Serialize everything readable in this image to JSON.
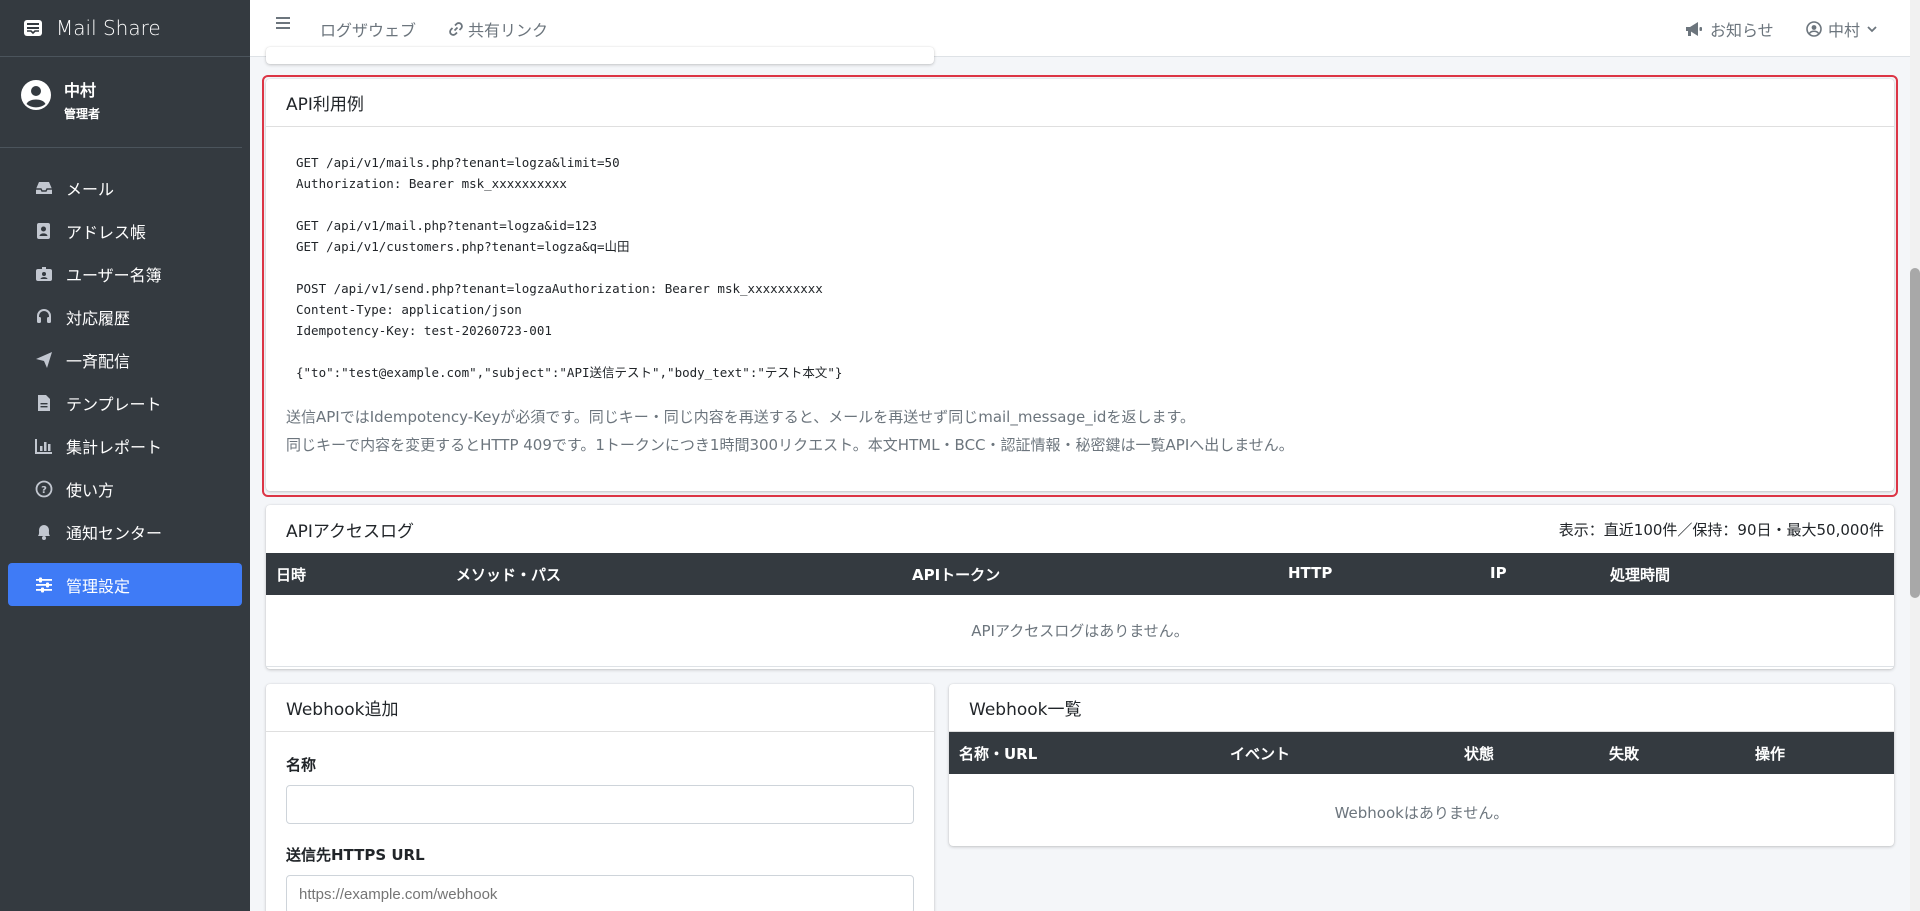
{
  "app": {
    "brand": "Mail Share"
  },
  "user": {
    "name": "中村",
    "role": "管理者"
  },
  "sidebar": {
    "items": [
      {
        "label": "メール",
        "icon": "inbox-icon"
      },
      {
        "label": "アドレス帳",
        "icon": "address-book-icon"
      },
      {
        "label": "ユーザー名簿",
        "icon": "id-card-icon"
      },
      {
        "label": "対応履歴",
        "icon": "headset-icon"
      },
      {
        "label": "一斉配信",
        "icon": "paper-plane-icon"
      },
      {
        "label": "テンプレート",
        "icon": "file-icon"
      },
      {
        "label": "集計レポート",
        "icon": "chart-icon"
      },
      {
        "label": "使い方",
        "icon": "question-icon"
      },
      {
        "label": "通知センター",
        "icon": "bell-icon"
      },
      {
        "label": "管理設定",
        "icon": "sliders-icon",
        "active": true
      }
    ]
  },
  "topbar": {
    "link1": "ログザウェブ",
    "link2": "共有リンク",
    "notice": "お知らせ",
    "user": "中村"
  },
  "api_example": {
    "title": "API利用例",
    "code": [
      "GET /api/v1/mails.php?tenant=logza&limit=50",
      "Authorization: Bearer msk_xxxxxxxxxx",
      "",
      "GET /api/v1/mail.php?tenant=logza&id=123",
      "GET /api/v1/customers.php?tenant=logza&q=山田",
      "",
      "POST /api/v1/send.php?tenant=logzaAuthorization: Bearer msk_xxxxxxxxxx",
      "Content-Type: application/json",
      "Idempotency-Key: test-20260723-001",
      "",
      "{\"to\":\"test@example.com\",\"subject\":\"API送信テスト\",\"body_text\":\"テスト本文\"}"
    ],
    "note1": "送信APIではIdempotency-Keyが必須です。同じキー・同じ内容を再送すると、メールを再送せず同じmail_message_idを返します。",
    "note2": "同じキーで内容を変更するとHTTP 409です。1トークンにつき1時間300リクエスト。本文HTML・BCC・認証情報・秘密鍵は一覧APIへ出しません。"
  },
  "access_log": {
    "title": "APIアクセスログ",
    "meta": "表示：直近100件／保持：90日・最大50,000件",
    "columns": [
      "日時",
      "メソッド・パス",
      "APIトークン",
      "HTTP",
      "IP",
      "処理時間"
    ],
    "empty": "APIアクセスログはありません。"
  },
  "webhook_add": {
    "title": "Webhook追加",
    "name_label": "名称",
    "name_value": "",
    "url_label": "送信先HTTPS URL",
    "url_placeholder": "https://example.com/webhook"
  },
  "webhook_list": {
    "title": "Webhook一覧",
    "columns": [
      "名称・URL",
      "イベント",
      "状態",
      "失敗",
      "操作"
    ],
    "empty": "Webhookはありません。"
  },
  "colors": {
    "sidebar_bg": "#343a40",
    "active_item": "#3f7bf6",
    "highlight_border": "#dc3545",
    "table_header": "#343a40"
  }
}
